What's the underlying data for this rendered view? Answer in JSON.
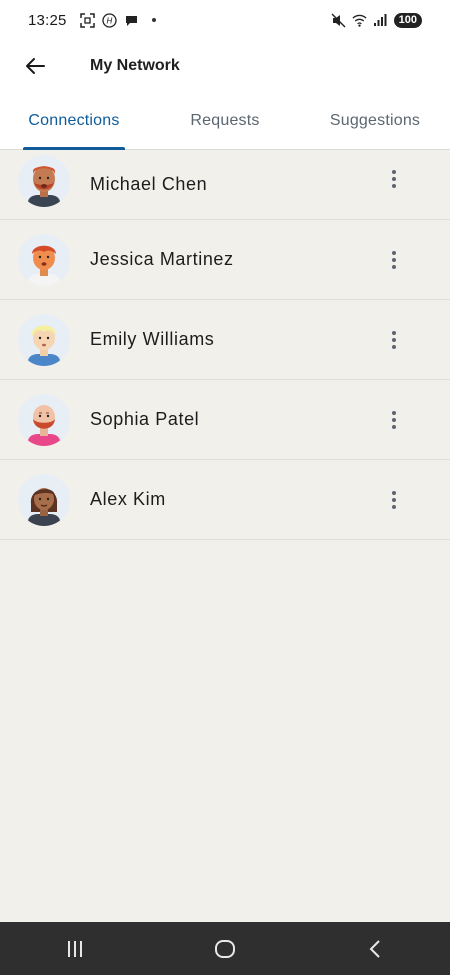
{
  "status_bar": {
    "time": "13:25",
    "battery": "100",
    "icons": [
      "screenshot-icon",
      "h-badge-icon",
      "chat-bubble-icon",
      "notification-dot",
      "mute-icon",
      "wifi-icon",
      "signal-icon",
      "battery-icon"
    ]
  },
  "app_bar": {
    "title": "My Network",
    "back_icon": "arrow-left-icon"
  },
  "tabs": [
    {
      "label": "Connections",
      "active": true
    },
    {
      "label": "Requests",
      "active": false
    },
    {
      "label": "Suggestions",
      "active": false
    }
  ],
  "connections": [
    {
      "name": "Michael Chen",
      "avatar": "avatar-man-red-hair-beard"
    },
    {
      "name": "Jessica Martinez",
      "avatar": "avatar-man-red-hair"
    },
    {
      "name": "Emily Williams",
      "avatar": "avatar-blonde-person"
    },
    {
      "name": "Sophia Patel",
      "avatar": "avatar-bald-man-beard"
    },
    {
      "name": "Alex Kim",
      "avatar": "avatar-woman-dark-hair"
    }
  ],
  "nav_bar": {
    "icons": [
      "recent-apps-icon",
      "home-icon",
      "back-icon"
    ]
  },
  "colors": {
    "accent": "#0f5c99",
    "background": "#f2f0ea",
    "nav_bar": "#2f2f2f"
  }
}
